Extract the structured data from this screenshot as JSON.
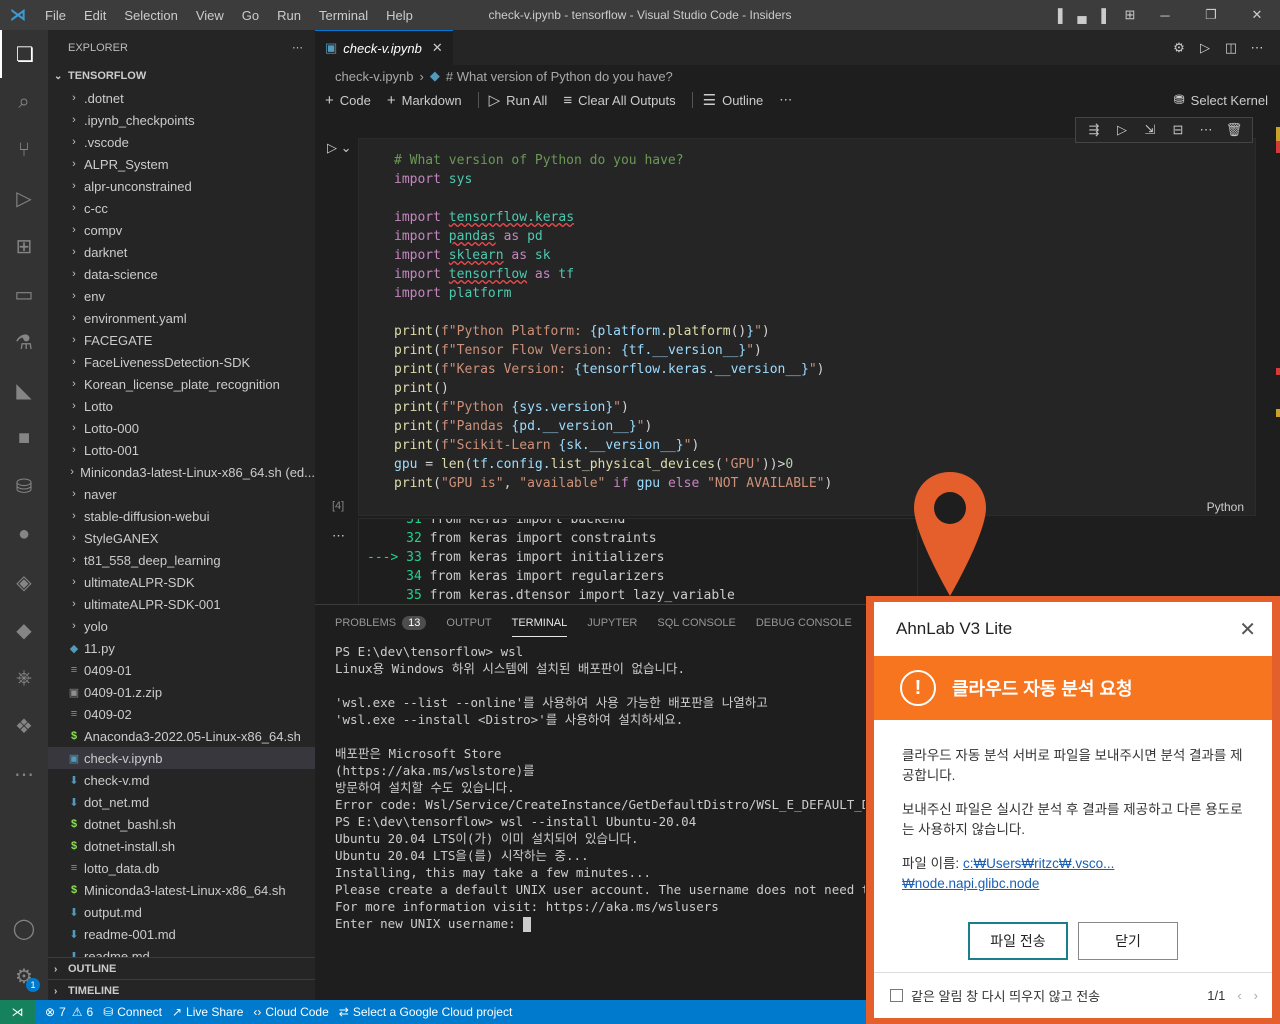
{
  "titlebar": {
    "menu": [
      "File",
      "Edit",
      "Selection",
      "View",
      "Go",
      "Run",
      "Terminal",
      "Help"
    ],
    "title": "check-v.ipynb - tensorflow - Visual Studio Code - Insiders"
  },
  "activity_bar": {
    "icons": [
      "explorer-icon",
      "search-icon",
      "source-control-icon",
      "run-debug-icon",
      "extensions-icon",
      "remote-explorer-icon",
      "testing-icon",
      "terraform-icon",
      "jupyter-icon",
      "database-icon",
      "json-icon",
      "python-icon",
      "docker-icon",
      "kubernetes-icon",
      "cloud-code-icon",
      "more-icon"
    ],
    "settings_badge": "1"
  },
  "explorer": {
    "header": "EXPLORER",
    "folder": "TENSORFLOW",
    "items": [
      {
        "label": ".dotnet",
        "type": "folder"
      },
      {
        "label": ".ipynb_checkpoints",
        "type": "folder"
      },
      {
        "label": ".vscode",
        "type": "folder"
      },
      {
        "label": "ALPR_System",
        "type": "folder"
      },
      {
        "label": "alpr-unconstrained",
        "type": "folder"
      },
      {
        "label": "c-cc",
        "type": "folder"
      },
      {
        "label": "compv",
        "type": "folder"
      },
      {
        "label": "darknet",
        "type": "folder"
      },
      {
        "label": "data-science",
        "type": "folder"
      },
      {
        "label": "env",
        "type": "folder"
      },
      {
        "label": "environment.yaml",
        "type": "folder"
      },
      {
        "label": "FACEGATE",
        "type": "folder"
      },
      {
        "label": "FaceLivenessDetection-SDK",
        "type": "folder"
      },
      {
        "label": "Korean_license_plate_recognition",
        "type": "folder"
      },
      {
        "label": "Lotto",
        "type": "folder"
      },
      {
        "label": "Lotto-000",
        "type": "folder"
      },
      {
        "label": "Lotto-001",
        "type": "folder"
      },
      {
        "label": "Miniconda3-latest-Linux-x86_64.sh (ed...",
        "type": "folder"
      },
      {
        "label": "naver",
        "type": "folder"
      },
      {
        "label": "stable-diffusion-webui",
        "type": "folder"
      },
      {
        "label": "StyleGANEX",
        "type": "folder"
      },
      {
        "label": "t81_558_deep_learning",
        "type": "folder"
      },
      {
        "label": "ultimateALPR-SDK",
        "type": "folder"
      },
      {
        "label": "ultimateALPR-SDK-001",
        "type": "folder"
      },
      {
        "label": "yolo",
        "type": "folder"
      },
      {
        "label": "11.py",
        "type": "py"
      },
      {
        "label": "0409-01",
        "type": "txt"
      },
      {
        "label": "0409-01.z.zip",
        "type": "zip"
      },
      {
        "label": "0409-02",
        "type": "txt"
      },
      {
        "label": "Anaconda3-2022.05-Linux-x86_64.sh",
        "type": "sh"
      },
      {
        "label": "check-v.ipynb",
        "type": "nb",
        "selected": true
      },
      {
        "label": "check-v.md",
        "type": "md"
      },
      {
        "label": "dot_net.md",
        "type": "md"
      },
      {
        "label": "dotnet_bashl.sh",
        "type": "sh"
      },
      {
        "label": "dotnet-install.sh",
        "type": "sh"
      },
      {
        "label": "lotto_data.db",
        "type": "txt"
      },
      {
        "label": "Miniconda3-latest-Linux-x86_64.sh",
        "type": "sh"
      },
      {
        "label": "output.md",
        "type": "md"
      },
      {
        "label": "readme-001.md",
        "type": "md"
      },
      {
        "label": "readme.md",
        "type": "md"
      }
    ],
    "outline": "OUTLINE",
    "timeline": "TIMELINE"
  },
  "editor": {
    "tab": "check-v.ipynb",
    "breadcrumb": [
      "check-v.ipynb",
      "# What version of Python do you have?"
    ],
    "toolbar": {
      "code": "Code",
      "markdown": "Markdown",
      "run_all": "Run All",
      "clear": "Clear All Outputs",
      "outline": "Outline"
    },
    "kernel": "Select Kernel",
    "exec_count": "[4]",
    "language": "Python",
    "output_lines": [
      {
        "n": "31",
        "code": "from keras import backend",
        "arrow": false
      },
      {
        "n": "32",
        "code": "from keras import constraints",
        "arrow": false
      },
      {
        "n": "33",
        "code": "from keras import initializers",
        "arrow": true
      },
      {
        "n": "34",
        "code": "from keras import regularizers",
        "arrow": false
      },
      {
        "n": "35",
        "code": "from keras.dtensor import lazy_variable",
        "arrow": false
      }
    ]
  },
  "panel": {
    "tabs": [
      "PROBLEMS",
      "OUTPUT",
      "TERMINAL",
      "JUPYTER",
      "SQL CONSOLE",
      "DEBUG CONSOLE"
    ],
    "problems_count": "13",
    "terminal_lines": [
      "PS E:\\dev\\tensorflow> wsl",
      "Linux용 Windows 하위 시스템에 설치된 배포판이 없습니다.",
      "",
      "'wsl.exe --list --online'를 사용하여 사용 가능한 배포판을 나열하고",
      "'wsl.exe --install <Distro>'를 사용하여 설치하세요.",
      "",
      "배포판은 Microsoft Store",
      "(https://aka.ms/wslstore)를",
      "방문하여 설치할 수도 있습니다.",
      "Error code: Wsl/Service/CreateInstance/GetDefaultDistro/WSL_E_DEFAULT_DISTRO_NOT_FOUND",
      "PS E:\\dev\\tensorflow> wsl --install Ubuntu-20.04",
      "Ubuntu 20.04 LTS이(가) 이미 설치되어 있습니다.",
      "Ubuntu 20.04 LTS을(를) 시작하는 중...",
      "Installing, this may take a few minutes...",
      "Please create a default UNIX user account. The username does not need to match",
      "For more information visit: https://aka.ms/wslusers",
      "Enter new UNIX username: "
    ]
  },
  "statusbar": {
    "errors": "7",
    "warnings": "6",
    "connect": "Connect",
    "live_share": "Live Share",
    "cloud_code": "Cloud Code",
    "gcp": "Select a Google Cloud project"
  },
  "dialog": {
    "title": "AhnLab V3 Lite",
    "band": "클라우드 자동 분석 요청",
    "p1": "클라우드 자동 분석 서버로 파일을 보내주시면 분석 결과를 제공합니다.",
    "p2": "보내주신 파일은 실시간 분석 후 결과를 제공하고 다른 용도로는 사용하지 않습니다.",
    "file_label": "파일 이름: ",
    "file_name": "c:₩Users₩ritzc₩.vsco...₩node.napi.glibc.node",
    "send": "파일 전송",
    "close": "닫기",
    "dont_show": "같은 알림 창 다시 띄우지 않고 전송",
    "page": "1/1",
    "accent": "#e45f2b",
    "band_color": "#f7751f"
  }
}
